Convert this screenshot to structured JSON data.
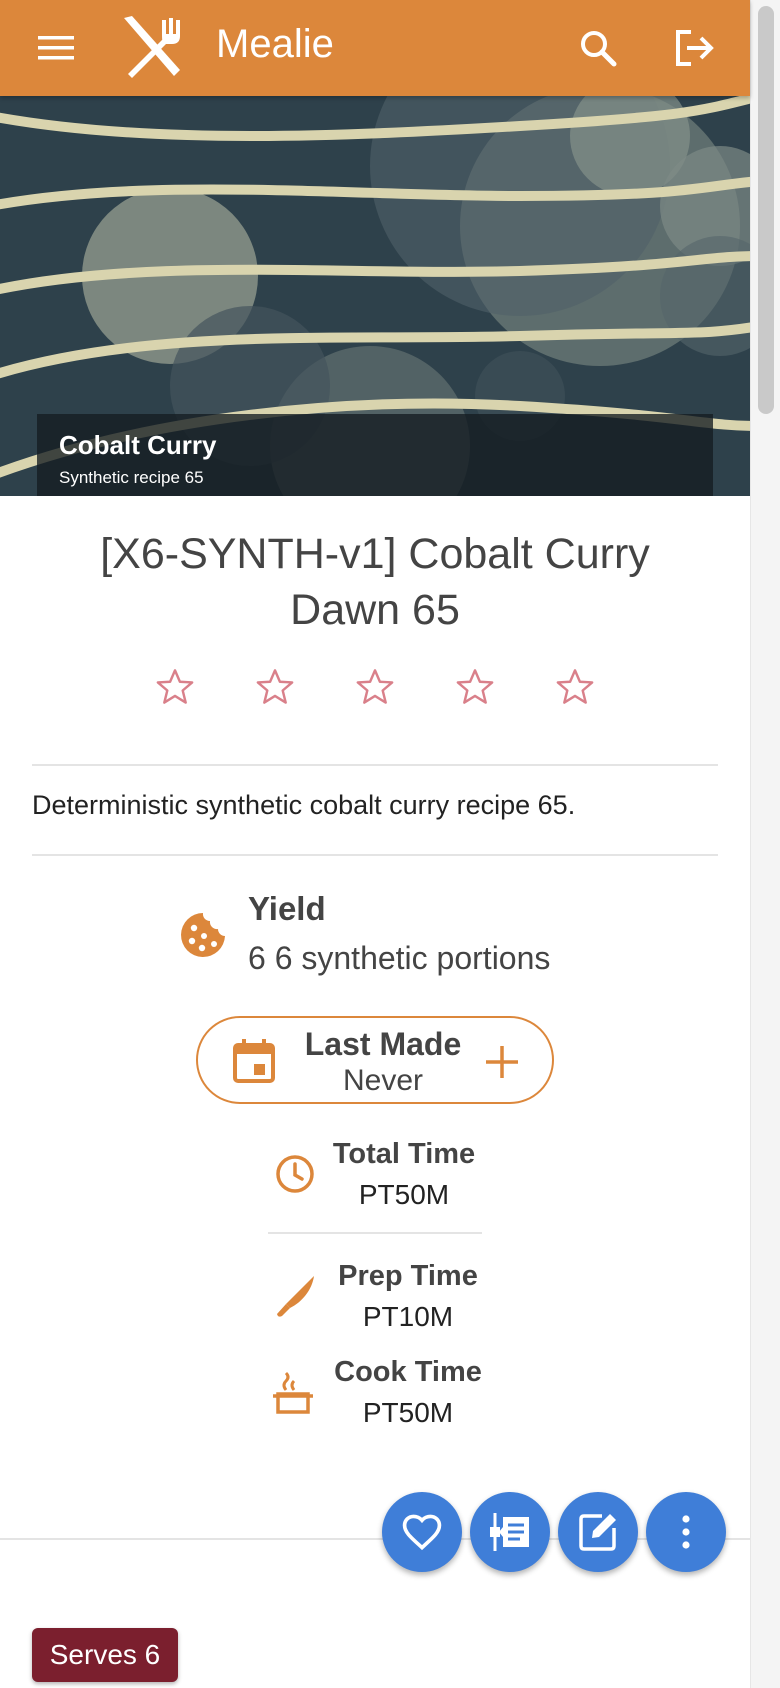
{
  "app": {
    "brand": "Mealie"
  },
  "hero": {
    "caption_title": "Cobalt Curry",
    "caption_subtitle": "Synthetic recipe 65"
  },
  "recipe": {
    "title": "[X6-SYNTH-v1] Cobalt Curry Dawn 65",
    "rating": 0,
    "rating_max": 5,
    "description": "Deterministic synthetic cobalt curry recipe 65.",
    "yield_label": "Yield",
    "yield_value": "6 6 synthetic portions",
    "last_made_label": "Last Made",
    "last_made_value": "Never",
    "total_time_label": "Total Time",
    "total_time_value": "PT50M",
    "prep_time_label": "Prep Time",
    "prep_time_value": "PT10M",
    "cook_time_label": "Cook Time",
    "cook_time_value": "PT50M",
    "serves_label": "Serves 6"
  },
  "icons": {
    "menu": "menu-icon",
    "logo": "fork-knife-logo-icon",
    "search": "search-icon",
    "logout": "logout-icon",
    "star": "star-outline-icon",
    "yield": "cookie-icon",
    "calendar": "calendar-icon",
    "plus": "plus-icon",
    "clock": "clock-icon",
    "knife": "knife-icon",
    "pot": "pot-steam-icon",
    "heart": "heart-outline-icon",
    "timeline": "timeline-text-icon",
    "edit": "pencil-box-icon",
    "more": "dots-vertical-icon"
  },
  "colors": {
    "primary": "#dc873b",
    "star": "#d9808a",
    "fab": "#3f7ed8",
    "serves_badge": "#7b1f2e"
  }
}
